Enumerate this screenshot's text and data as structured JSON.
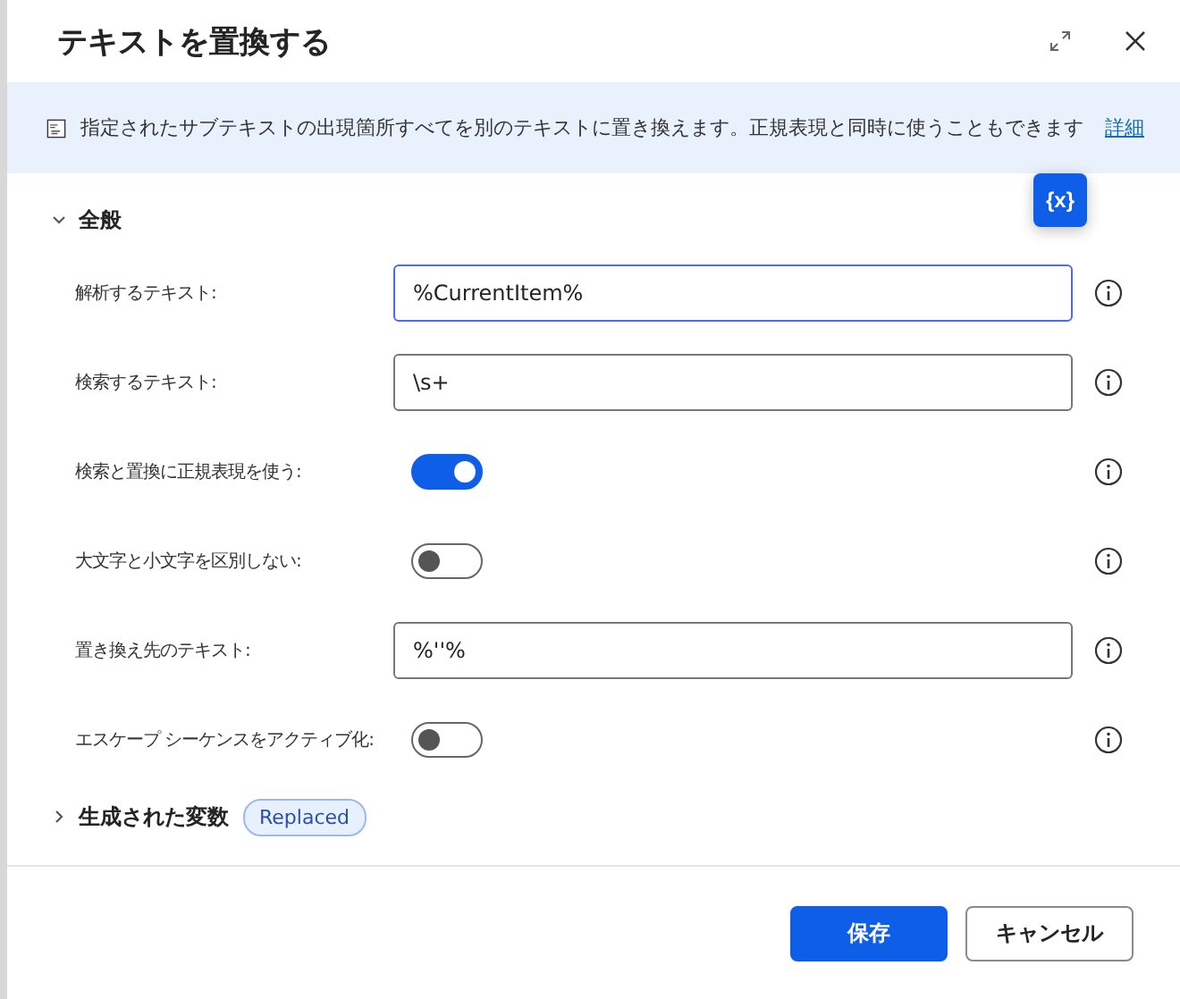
{
  "dialog": {
    "title": "テキストを置換する"
  },
  "banner": {
    "text": "指定されたサブテキストの出現箇所すべてを別のテキストに置き換えます。正規表現と同時に使うこともできます",
    "link": "詳細"
  },
  "general": {
    "title": "全般",
    "expanded": true,
    "variable_button": "{x}",
    "fields": [
      {
        "kind": "text",
        "label": "解析するテキスト:",
        "value": "%CurrentItem%",
        "focused": true
      },
      {
        "kind": "text",
        "label": "検索するテキスト:",
        "value": "\\s+",
        "focused": false
      },
      {
        "kind": "toggle",
        "label": "検索と置換に正規表現を使う:",
        "on": true
      },
      {
        "kind": "toggle",
        "label": "大文字と小文字を区別しない:",
        "on": false
      },
      {
        "kind": "text",
        "label": "置き換え先のテキスト:",
        "value": "%''%",
        "focused": false
      },
      {
        "kind": "toggle",
        "label": "エスケープ シーケンスをアクティブ化:",
        "on": false
      }
    ]
  },
  "variables": {
    "title": "生成された変数",
    "expanded": false,
    "tags": [
      "Replaced"
    ]
  },
  "buttons": [
    {
      "label": "保存",
      "primary": true
    },
    {
      "label": "キャンセル",
      "primary": false
    }
  ]
}
